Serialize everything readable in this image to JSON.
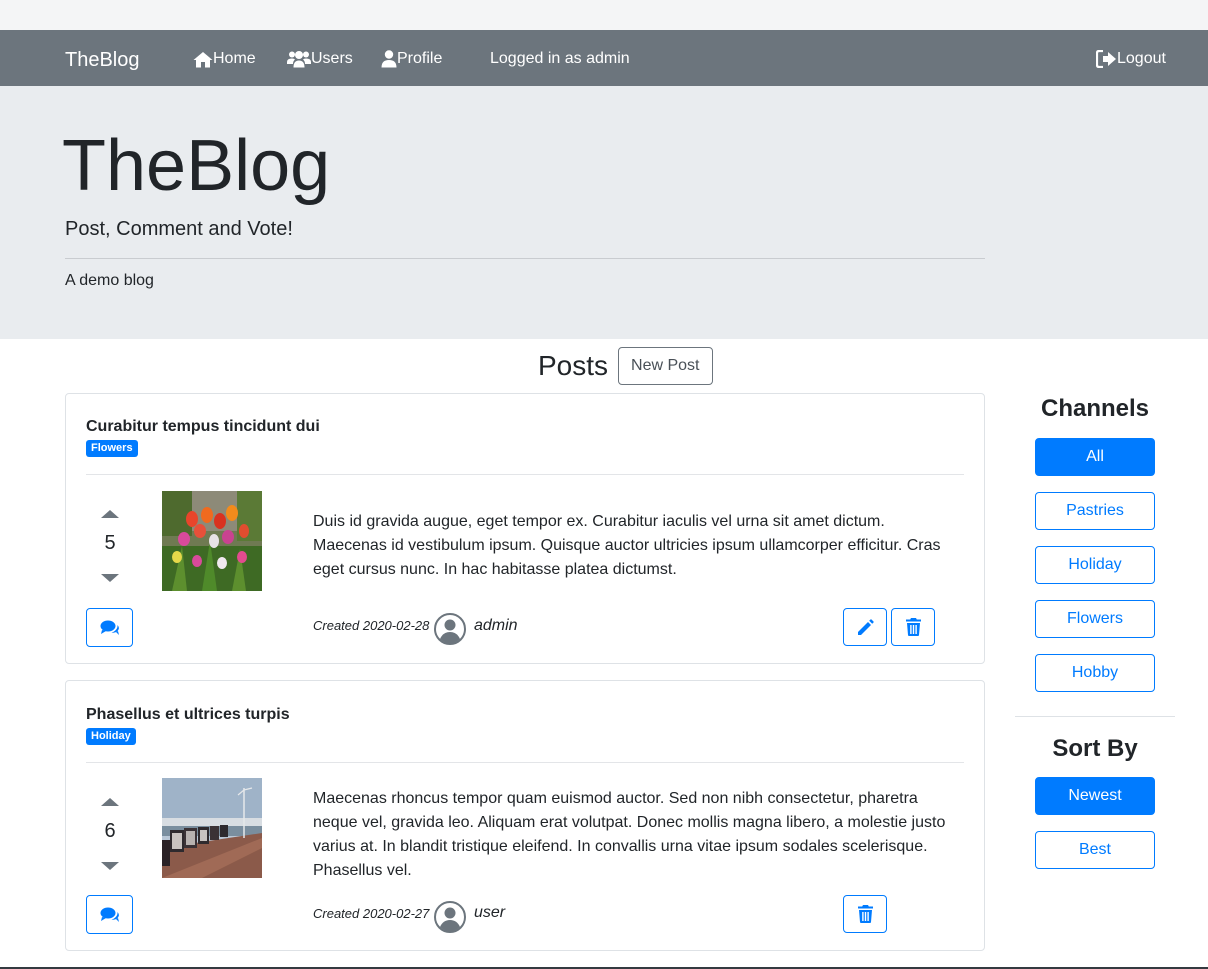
{
  "nav": {
    "brand": "TheBlog",
    "home": "Home",
    "users": "Users",
    "profile": "Profile",
    "logged_in": "Logged in as admin",
    "logout": "Logout"
  },
  "jumbotron": {
    "title": "TheBlog",
    "lead": "Post, Comment and Vote!",
    "description": "A demo blog"
  },
  "posts_section": {
    "title": "Posts",
    "new_post_label": "New Post"
  },
  "posts": [
    {
      "title": "Curabitur tempus tincidunt dui",
      "channel": "Flowers",
      "votes": "5",
      "text": "Duis id gravida augue, eget tempor ex. Curabitur iaculis vel urna sit amet dictum. Maecenas id vestibulum ipsum. Quisque auctor ultricies ipsum ullamcorper efficitur. Cras eget cursus nunc. In hac habitasse platea dictumst.",
      "created": "Created 2020-02-28",
      "author": "admin"
    },
    {
      "title": "Phasellus et ultrices turpis",
      "channel": "Holiday",
      "votes": "6",
      "text": "Maecenas rhoncus tempor quam euismod auctor. Sed non nibh consectetur, pharetra neque vel, gravida leo. Aliquam erat volutpat. Donec mollis magna libero, a molestie justo varius at. In blandit tristique eleifend. In convallis urna vitae ipsum sodales scelerisque. Phasellus vel.",
      "created": "Created 2020-02-27",
      "author": "user"
    }
  ],
  "sidebar": {
    "channels_title": "Channels",
    "channels": [
      "All",
      "Pastries",
      "Holiday",
      "Flowers",
      "Hobby"
    ],
    "active_channel": "All",
    "sort_title": "Sort By",
    "sort_options": [
      "Newest",
      "Best"
    ],
    "active_sort": "Newest"
  },
  "colors": {
    "primary": "#007bff",
    "navbar": "#6c757d",
    "jumbotron": "#e9ecef"
  }
}
